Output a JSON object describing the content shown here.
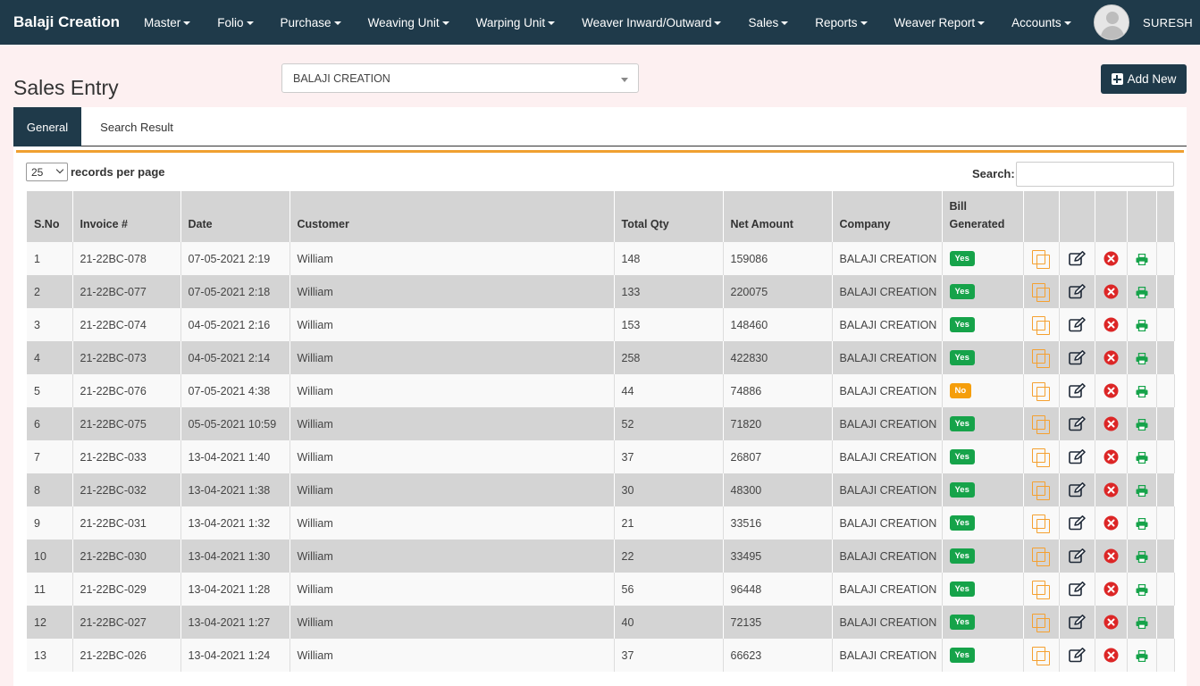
{
  "app": {
    "brand": "Balaji Creation",
    "username": "SURESH"
  },
  "nav": [
    "Master",
    "Folio",
    "Purchase",
    "Weaving Unit",
    "Warping Unit",
    "Weaver Inward/Outward",
    "Sales",
    "Reports",
    "Weaver Report",
    "Accounts"
  ],
  "page": {
    "title": "Sales Entry",
    "company_selected": "BALAJI CREATION",
    "add_new_label": "Add New"
  },
  "tabs": {
    "general": "General",
    "search_result": "Search Result"
  },
  "table_controls": {
    "page_length": "25",
    "page_length_label": "records per page",
    "search_label": "Search:"
  },
  "table": {
    "headers": [
      "S.No",
      "Invoice #",
      "Date",
      "Customer",
      "Total Qty",
      "Net Amount",
      "Company",
      "Bill Generated"
    ],
    "rows": [
      [
        "1",
        "21-22BC-078",
        "07-05-2021 2:19",
        "William",
        "148",
        "159086",
        "BALAJI CREATION",
        "Yes"
      ],
      [
        "2",
        "21-22BC-077",
        "07-05-2021 2:18",
        "William",
        "133",
        "220075",
        "BALAJI CREATION",
        "Yes"
      ],
      [
        "3",
        "21-22BC-074",
        "04-05-2021 2:16",
        "William",
        "153",
        "148460",
        "BALAJI CREATION",
        "Yes"
      ],
      [
        "4",
        "21-22BC-073",
        "04-05-2021 2:14",
        "William",
        "258",
        "422830",
        "BALAJI CREATION",
        "Yes"
      ],
      [
        "5",
        "21-22BC-076",
        "07-05-2021 4:38",
        "William",
        "44",
        "74886",
        "BALAJI CREATION",
        "No"
      ],
      [
        "6",
        "21-22BC-075",
        "05-05-2021 10:59",
        "William",
        "52",
        "71820",
        "BALAJI CREATION",
        "Yes"
      ],
      [
        "7",
        "21-22BC-033",
        "13-04-2021 1:40",
        "William",
        "37",
        "26807",
        "BALAJI CREATION",
        "Yes"
      ],
      [
        "8",
        "21-22BC-032",
        "13-04-2021 1:38",
        "William",
        "30",
        "48300",
        "BALAJI CREATION",
        "Yes"
      ],
      [
        "9",
        "21-22BC-031",
        "13-04-2021 1:32",
        "William",
        "21",
        "33516",
        "BALAJI CREATION",
        "Yes"
      ],
      [
        "10",
        "21-22BC-030",
        "13-04-2021 1:30",
        "William",
        "22",
        "33495",
        "BALAJI CREATION",
        "Yes"
      ],
      [
        "11",
        "21-22BC-029",
        "13-04-2021 1:28",
        "William",
        "56",
        "96448",
        "BALAJI CREATION",
        "Yes"
      ],
      [
        "12",
        "21-22BC-027",
        "13-04-2021 1:27",
        "William",
        "40",
        "72135",
        "BALAJI CREATION",
        "Yes"
      ],
      [
        "13",
        "21-22BC-026",
        "13-04-2021 1:24",
        "William",
        "37",
        "66623",
        "BALAJI CREATION",
        "Yes"
      ]
    ],
    "row_actions": [
      "copy-icon",
      "edit-icon",
      "delete-icon",
      "print-icon"
    ]
  },
  "colors": {
    "navbar": "#1f3a4a",
    "yes_badge": "#16a34a",
    "no_badge": "#f59e0b",
    "copy": "#f5a030",
    "delete": "#dc2626",
    "print": "#16a34a",
    "accent_line": "#f0a030"
  }
}
